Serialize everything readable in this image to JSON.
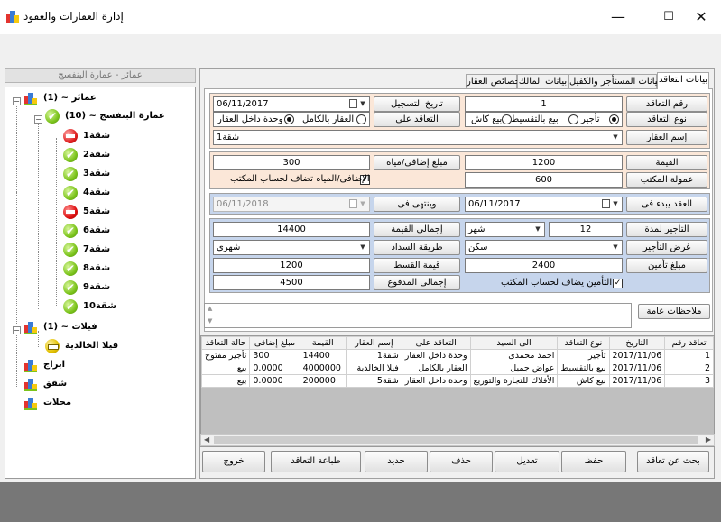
{
  "window": {
    "title": "إدارة العقارات والعقود",
    "minimize": "—",
    "maximize": "☐",
    "close": "✕"
  },
  "sidebar": {
    "header": "عمائر - عمارة البنفسج",
    "tree": {
      "root1": "(1) ~ عمائر",
      "building": "(10) ~ عمارة البنفسج",
      "units": [
        "شقة1",
        "شقة2",
        "شقة3",
        "شقة4",
        "شقة5",
        "شقة6",
        "شقة7",
        "شقة8",
        "شقة9",
        "شقة10"
      ],
      "root2": "(1) ~ فيلات",
      "villa": "فيلا الخالدية",
      "root3": "ابراج",
      "root4": "شقق",
      "root5": "محلات"
    }
  },
  "tabs": [
    "بيانات التعاقد",
    "بيانات المستأجر والكفيل",
    "بيانات المالك",
    "خصائص العقار"
  ],
  "form": {
    "contract_no_label": "رقم التعاقد",
    "contract_no": "1",
    "reg_date_label": "تاريخ التسجيل",
    "reg_date": "06/11/2017",
    "contract_type_label": "نوع التعاقد",
    "type_options": [
      "تأجير",
      "بيع بالتقسيط",
      "بيع كاش"
    ],
    "contract_on_label": "التعاقد على",
    "on_options": [
      "العقار بالكامل",
      "وحدة داخل العقار"
    ],
    "property_name_label": "إسم العقار",
    "property_name": "شقة1",
    "value_label": "القيمة",
    "value": "1200",
    "extra_label": "مبلغ إضافى/مياه",
    "extra": "300",
    "commission_label": "عمولة المكتب",
    "commission": "600",
    "extra_to_office_label": "الإضافى/المياه تضاف لحساب المكتب",
    "start_label": "العقد يبدء فى",
    "start": "06/11/2017",
    "end_label": "وينتهى فى",
    "end": "06/11/2018",
    "duration_label": "التأجير لمدة",
    "duration": "12",
    "duration_unit": "شهر",
    "total_value_label": "إجمالى القيمة",
    "total_value": "14400",
    "purpose_label": "غرض التأجير",
    "purpose": "سكن",
    "payment_method_label": "طريقة السداد",
    "payment_method": "شهرى",
    "insurance_label": "مبلغ تأمين",
    "insurance": "2400",
    "installment_label": "قيمة القسط",
    "installment": "1200",
    "paid_label": "إجمالى المدفوع",
    "paid": "4500",
    "insurance_to_office_label": "التأمين يضاف لحساب المكتب",
    "notes_label": "ملاحظات عامة",
    "check_mark": "✓",
    "combo_arrow": "▼",
    "scroll_up": "▲",
    "scroll_down": "▼"
  },
  "table": {
    "headers": [
      "تعاقد رقم",
      "التاريخ",
      "نوع التعاقد",
      "الى السيد",
      "التعاقد على",
      "إسم العقار",
      "القيمة",
      "مبلغ إضافى",
      "حالة التعاقد"
    ],
    "rows": [
      [
        "1",
        "2017/11/06",
        "تأجير",
        "احمد محمدى",
        "وحدة داخل العقار",
        "شقة1",
        "14400",
        "300",
        "تأجير مفتوح"
      ],
      [
        "2",
        "2017/11/06",
        "بيع بالتقسيط",
        "عواض جميل",
        "العقار بالكامل",
        "فيلا الخالدية",
        "4000000",
        "0.0000",
        "بيع"
      ],
      [
        "3",
        "2017/11/06",
        "بيع كاش",
        "الأفلاك للتجارة والتوزيع",
        "وحدة داخل العقار",
        "شقة5",
        "200000",
        "0.0000",
        "بيع"
      ]
    ],
    "scroll_left": "◀",
    "scroll_right": "▶"
  },
  "buttons": [
    "بحث عن تعاقد",
    "حفظ",
    "تعديل",
    "حذف",
    "جديد",
    "طباعة التعاقد",
    "خروج"
  ],
  "colors": {
    "salmon": "#fbe7d8",
    "blue": "#c6d5ec",
    "grid_bg": "#bfbfbf"
  }
}
